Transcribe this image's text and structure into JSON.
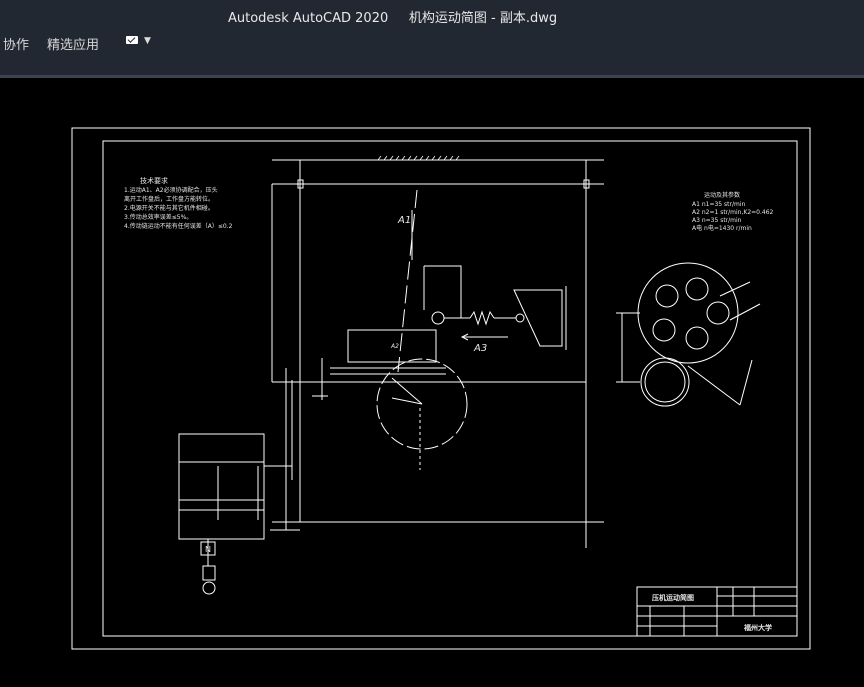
{
  "window": {
    "title": "Autodesk AutoCAD 2020     机构运动简图 - 副本.dwg"
  },
  "ribbon": {
    "tabs": [
      {
        "label": "协作"
      },
      {
        "label": "精选应用"
      }
    ],
    "mail_icon": "envelope-icon"
  },
  "drawing": {
    "notes_title": "技术要求",
    "notes": [
      "1.运动A1、A2必须协调配合，压头",
      "离开工作盘后，工作盘方能转位。",
      "2.电源开关不能与其它机件相碰。",
      "3.传动总效率误差≤5%。",
      "4.传动链运动不能有任何误差（A）≤0.2"
    ],
    "params_title": "运动及其参数",
    "params": [
      "A1  n1=35 str/min",
      "A2  n2=1 str/min,K2=0.462",
      "A3  n=35 str/min",
      "A电  n电=1430 r/min"
    ],
    "labels": {
      "a1": "A1",
      "a3": "A3",
      "a2": "A2",
      "motor": "N"
    },
    "title_block": {
      "name": "压机运动简图",
      "school": "福州大学"
    }
  },
  "colors": {
    "chrome": "#222831",
    "line": "#ffffff",
    "canvas": "#000000"
  }
}
